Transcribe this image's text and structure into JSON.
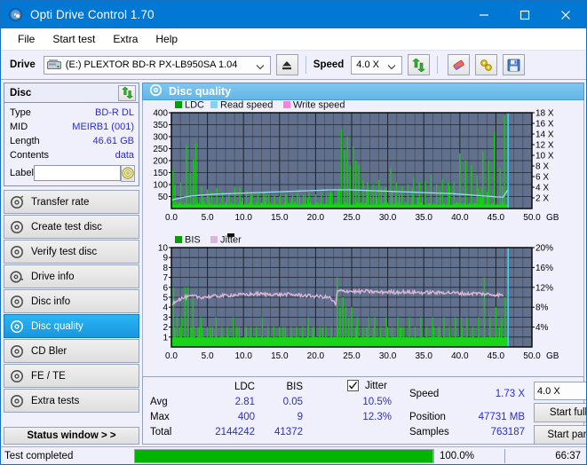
{
  "window": {
    "title": "Opti Drive Control 1.70",
    "icon": "disc-icon",
    "minimize": "minimize-icon",
    "maximize": "maximize-icon",
    "close": "close-icon"
  },
  "menu": {
    "items": [
      "File",
      "Start test",
      "Extra",
      "Help"
    ]
  },
  "toolbar": {
    "drive_label": "Drive",
    "drive_value": "(E:)   PLEXTOR BD-R  PX-LB950SA 1.04",
    "eject_icon": "eject-icon",
    "speed_label": "Speed",
    "speed_value": "4.0 X",
    "refresh_icon": "refresh-icon",
    "erase_icon": "eraser-icon",
    "tools_icon": "tools-icon",
    "save_icon": "save-icon"
  },
  "disc": {
    "title": "Disc",
    "refresh_icon": "refresh-icon",
    "rows": [
      {
        "label": "Type",
        "value": "BD-R DL"
      },
      {
        "label": "MID",
        "value": "MEIRB1 (001)"
      },
      {
        "label": "Length",
        "value": "46.61 GB"
      },
      {
        "label": "Contents",
        "value": "data"
      }
    ],
    "label_label": "Label",
    "label_value": "",
    "label_placeholder": "",
    "label_icon": "disc-label-icon"
  },
  "nav": {
    "items": [
      {
        "label": "Transfer rate",
        "icon": "disc-icon",
        "active": false
      },
      {
        "label": "Create test disc",
        "icon": "disc-icon",
        "active": false
      },
      {
        "label": "Verify test disc",
        "icon": "disc-icon",
        "active": false
      },
      {
        "label": "Drive info",
        "icon": "drive-icon",
        "active": false
      },
      {
        "label": "Disc info",
        "icon": "disc-icon",
        "active": false
      },
      {
        "label": "Disc quality",
        "icon": "disc-icon",
        "active": true
      },
      {
        "label": "CD Bler",
        "icon": "disc-icon",
        "active": false
      },
      {
        "label": "FE / TE",
        "icon": "disc-icon",
        "active": false
      },
      {
        "label": "Extra tests",
        "icon": "disc-icon",
        "active": false
      }
    ],
    "status_window": "Status window > >"
  },
  "panel": {
    "header": "Disc quality",
    "header_icon": "disc-quality-icon"
  },
  "stats": {
    "col_headers": [
      "LDC",
      "BIS"
    ],
    "row_labels": [
      "Avg",
      "Max",
      "Total"
    ],
    "ldc": {
      "avg": "2.81",
      "max": "400",
      "total": "2144242"
    },
    "bis": {
      "avg": "0.05",
      "max": "9",
      "total": "41372"
    },
    "jitter": {
      "label": "Jitter",
      "checked": true,
      "avg": "10.5%",
      "max": "12.3%"
    },
    "speed_label": "Speed",
    "speed_value": "1.73 X",
    "position_label": "Position",
    "position_value": "47731 MB",
    "samples_label": "Samples",
    "samples_value": "763187",
    "speed_select": "4.0 X",
    "start_full": "Start full",
    "start_part": "Start part"
  },
  "statusbar": {
    "text": "Test completed",
    "progress": 100,
    "percent": "100.0%",
    "time": "66:37"
  },
  "chart_data": [
    {
      "type": "line",
      "name": "ldc-chart",
      "title": "",
      "legend": [
        {
          "label": "LDC",
          "color": "#00a000"
        },
        {
          "label": "Read speed",
          "color": "#7fd4f5"
        },
        {
          "label": "Write speed",
          "color": "#ff7fe0"
        }
      ],
      "legend_position": "top-left",
      "xlabel": "GB",
      "x_ticks": [
        "0.0",
        "5.0",
        "10.0",
        "15.0",
        "20.0",
        "25.0",
        "30.0",
        "35.0",
        "40.0",
        "45.0",
        "50.0"
      ],
      "xlim": [
        0,
        50
      ],
      "ylabel_left": "LDC",
      "y_ticks_left": [
        50,
        100,
        150,
        200,
        250,
        300,
        350,
        400
      ],
      "ylim_left": [
        0,
        400
      ],
      "ylabel_right": "X",
      "y_ticks_right": [
        "2 X",
        "4 X",
        "6 X",
        "8 X",
        "10 X",
        "12 X",
        "14 X",
        "16 X",
        "18 X"
      ],
      "ylim_right": [
        0,
        18
      ],
      "grid": true,
      "plot_bg": "#61708c",
      "scan_end_marker_gb": 46.7,
      "series": [
        {
          "name": "Read speed",
          "color": "#9fd8f2",
          "x": [
            0.0,
            1.0,
            2.0,
            3.0,
            4.0,
            5.0,
            6.0,
            7.0,
            8.0,
            9.0,
            10.0,
            11.0,
            12.0,
            13.0,
            14.0,
            15.0,
            16.0,
            17.0,
            18.0,
            19.0,
            20.0,
            21.0,
            22.0,
            23.0,
            24.0,
            25.0,
            26.0,
            27.0,
            28.0,
            29.0,
            30.0,
            31.0,
            32.0,
            33.0,
            34.0,
            35.0,
            36.0,
            37.0,
            38.0,
            39.0,
            40.0,
            41.0,
            42.0,
            43.0,
            44.0,
            45.0,
            46.0,
            46.7
          ],
          "values_x": [
            1.6,
            1.9,
            2.2,
            2.4,
            2.5,
            2.6,
            2.7,
            2.75,
            2.8,
            2.85,
            2.9,
            2.95,
            3.0,
            3.05,
            3.1,
            3.15,
            3.2,
            3.25,
            3.3,
            3.35,
            3.4,
            3.45,
            3.5,
            3.5,
            3.5,
            3.5,
            3.45,
            3.4,
            3.35,
            3.3,
            3.25,
            3.2,
            3.15,
            3.1,
            3.05,
            3.0,
            2.95,
            2.9,
            2.85,
            2.8,
            2.7,
            2.6,
            2.5,
            2.4,
            2.3,
            2.2,
            2.15,
            3.6
          ]
        },
        {
          "name": "LDC",
          "color": "#00c000",
          "description": "Dense green vertical error spikes across full scan, baseline ~20-40, periodic peaks 150-400",
          "x_spikes": [
            0.2,
            0.5,
            1.3,
            2.1,
            2.6,
            3.1,
            3.4,
            4.2,
            5.0,
            5.6,
            6.3,
            7.1,
            8.0,
            8.8,
            9.5,
            10.4,
            11.2,
            12.0,
            12.8,
            13.5,
            14.3,
            15.1,
            16.0,
            16.8,
            17.5,
            18.3,
            19.1,
            20.0,
            20.8,
            21.5,
            22.3,
            23.1,
            23.6,
            24.0,
            24.4,
            24.8,
            25.2,
            25.6,
            26.0,
            26.6,
            27.2,
            28.0,
            28.8,
            29.6,
            30.4,
            31.2,
            32.0,
            32.8,
            33.6,
            34.4,
            35.2,
            36.0,
            36.8,
            37.6,
            38.4,
            39.2,
            40.0,
            40.8,
            41.6,
            42.4,
            43.2,
            44.0,
            44.8,
            45.6,
            46.2
          ],
          "values_spikes": [
            160,
            100,
            110,
            265,
            150,
            205,
            272,
            90,
            80,
            70,
            85,
            70,
            60,
            90,
            70,
            75,
            60,
            65,
            70,
            60,
            55,
            65,
            60,
            60,
            70,
            60,
            65,
            60,
            70,
            60,
            65,
            75,
            330,
            245,
            300,
            180,
            260,
            200,
            180,
            120,
            110,
            100,
            120,
            90,
            170,
            110,
            95,
            100,
            130,
            110,
            115,
            140,
            100,
            120,
            110,
            115,
            230,
            200,
            180,
            140,
            240,
            200,
            320,
            170,
            390
          ]
        }
      ]
    },
    {
      "type": "line",
      "name": "bis-chart",
      "title": "",
      "legend": [
        {
          "label": "BIS",
          "color": "#00a000"
        },
        {
          "label": "Jitter",
          "color": "#dcb4dc"
        }
      ],
      "legend_position": "top-left",
      "xlabel": "GB",
      "x_ticks": [
        "0.0",
        "5.0",
        "10.0",
        "15.0",
        "20.0",
        "25.0",
        "30.0",
        "35.0",
        "40.0",
        "45.0",
        "50.0"
      ],
      "xlim": [
        0,
        50
      ],
      "ylabel_left": "BIS",
      "y_ticks_left": [
        1,
        2,
        3,
        4,
        5,
        6,
        7,
        8,
        9,
        10
      ],
      "ylim_left": [
        0,
        10
      ],
      "ylabel_right": "%",
      "y_ticks_right": [
        "4%",
        "8%",
        "12%",
        "16%",
        "20%"
      ],
      "ylim_right": [
        0,
        20
      ],
      "grid": true,
      "plot_bg": "#61708c",
      "scan_end_marker_gb": 46.7,
      "series": [
        {
          "name": "Jitter",
          "color": "#dcb4dc",
          "x": [
            0.0,
            0.5,
            1.0,
            1.5,
            2.0,
            2.5,
            3.0,
            3.5,
            4.0,
            5.0,
            6.0,
            7.0,
            8.0,
            9.0,
            10.0,
            11.0,
            12.0,
            13.0,
            14.0,
            15.0,
            16.0,
            17.0,
            18.0,
            19.0,
            20.0,
            21.0,
            22.0,
            22.8,
            23.0,
            24.0,
            25.0,
            26.0,
            27.0,
            28.0,
            29.0,
            30.0,
            31.0,
            32.0,
            33.0,
            34.0,
            35.0,
            36.0,
            37.0,
            38.0,
            39.0,
            40.0,
            41.0,
            42.0,
            43.0,
            44.0,
            45.0,
            46.0
          ],
          "values_pct": [
            8.6,
            9.2,
            9.6,
            9.8,
            10.0,
            10.1,
            10.2,
            10.1,
            10.0,
            10.1,
            10.2,
            10.3,
            10.4,
            10.5,
            10.5,
            10.6,
            10.7,
            10.6,
            10.6,
            10.5,
            10.6,
            10.5,
            10.4,
            10.3,
            10.2,
            10.1,
            9.9,
            8.5,
            11.2,
            11.3,
            11.2,
            11.1,
            11.2,
            11.1,
            11.0,
            11.1,
            11.0,
            11.1,
            11.0,
            11.0,
            10.9,
            11.0,
            10.9,
            11.0,
            10.9,
            10.8,
            10.7,
            10.8,
            10.7,
            10.6,
            10.5,
            10.4
          ]
        },
        {
          "name": "BIS",
          "color": "#00c000",
          "description": "Dense green bars, baseline ~1, frequent bars to 2, occasional to 3-7",
          "x_spikes": [
            0.3,
            0.8,
            1.4,
            1.9,
            2.3,
            2.7,
            3.0,
            3.2,
            4.1,
            5.0,
            5.4,
            6.2,
            7.0,
            7.8,
            8.6,
            9.0,
            9.4,
            10.2,
            11.0,
            11.8,
            12.6,
            13.4,
            14.2,
            15.0,
            15.8,
            16.6,
            17.4,
            18.2,
            19.0,
            19.8,
            20.6,
            21.4,
            22.2,
            23.0,
            23.4,
            23.8,
            24.2,
            24.6,
            25.0,
            25.8,
            26.6,
            27.4,
            28.2,
            29.0,
            29.8,
            30.6,
            31.4,
            32.2,
            33.0,
            33.8,
            34.6,
            35.4,
            36.2,
            37.0,
            37.8,
            38.6,
            39.4,
            40.2,
            41.0,
            41.8,
            42.6,
            43.4,
            44.2,
            45.0,
            45.8,
            46.3
          ],
          "values_spikes": [
            6,
            3,
            3,
            6,
            6,
            2,
            5,
            2,
            3,
            2,
            2,
            3,
            2,
            2,
            3,
            2,
            2,
            2,
            2,
            2,
            3,
            2,
            2,
            2,
            2,
            2,
            2,
            2,
            3,
            2,
            2,
            2,
            2,
            7,
            4,
            5,
            4,
            3,
            4,
            3,
            2,
            3,
            3,
            2,
            3,
            2,
            3,
            2,
            3,
            2,
            3,
            2,
            3,
            2,
            3,
            2,
            3,
            3,
            3,
            2,
            3,
            7,
            3,
            4,
            3,
            5
          ]
        }
      ]
    }
  ]
}
